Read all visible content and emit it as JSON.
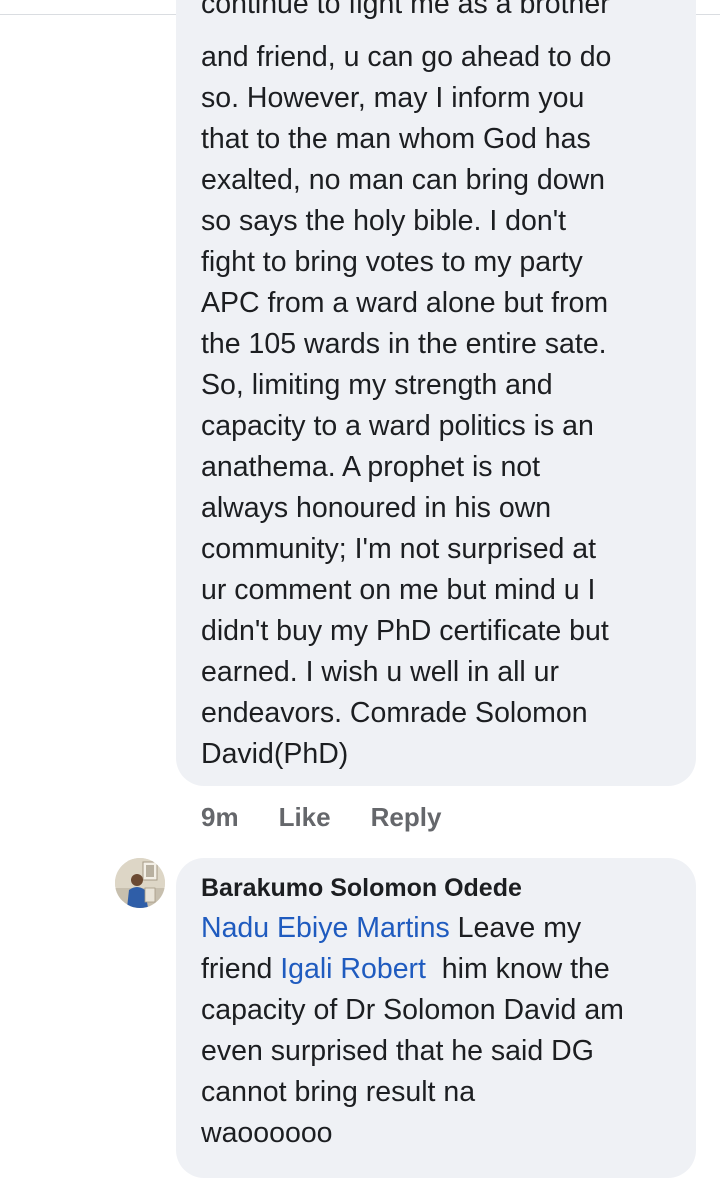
{
  "comment_1": {
    "partial_first_line": "continue to fight me as a brother",
    "lines": [
      "and friend, u can go ahead to do",
      "so. However, may I inform you",
      "that to the man whom God has",
      "exalted, no man can bring down",
      "so says the holy bible. I don't",
      "fight to bring votes to my party",
      "APC from a ward alone but from",
      "the 105 wards in the entire sate.",
      "So, limiting my strength and",
      "capacity to a ward politics is an",
      "anathema. A prophet is not",
      "always honoured in his own",
      "community; I'm not surprised at",
      "ur comment on me but mind u I",
      "didn't buy my PhD certificate but",
      "earned. I wish u well in all ur",
      "endeavors. Comrade Solomon",
      "David(PhD)"
    ],
    "time": "9m",
    "like_label": "Like",
    "reply_label": "Reply"
  },
  "comment_2": {
    "author": "Barakumo Solomon Odede",
    "mention_1": "Nadu Ebiye Martins",
    "text_1": " Leave my",
    "text_2": "friend ",
    "mention_2": "Igali Robert",
    "text_3": "  him know the",
    "lines": [
      "capacity of Dr Solomon David am",
      "even surprised that he said DG",
      "cannot bring result na",
      "waoooooo"
    ]
  },
  "colors": {
    "bubble": "#eff1f5",
    "text": "#1c1e21",
    "meta": "#65676b",
    "mention": "#1f5bbf"
  },
  "icons": {
    "avatar": "user-avatar-photo"
  }
}
